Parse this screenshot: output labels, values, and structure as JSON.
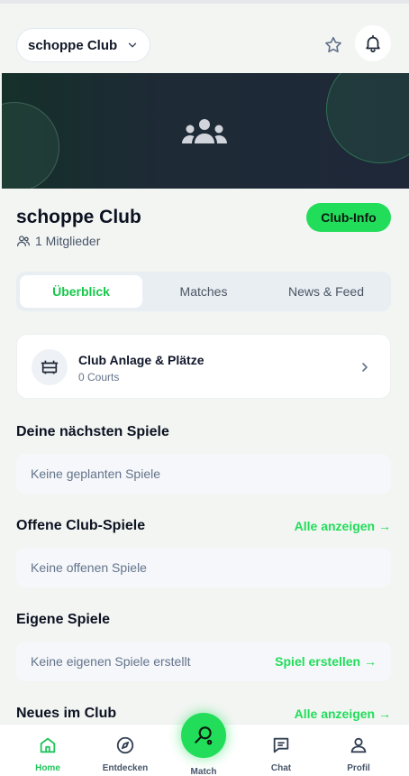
{
  "header": {
    "club_selector": "schoppe Club"
  },
  "club": {
    "name": "schoppe Club",
    "members": "1 Mitglieder",
    "info_button": "Club-Info"
  },
  "tabs": [
    {
      "label": "Überblick",
      "active": true
    },
    {
      "label": "Matches",
      "active": false
    },
    {
      "label": "News & Feed",
      "active": false
    }
  ],
  "courts": {
    "title": "Club Anlage & Plätze",
    "subtitle": "0 Courts"
  },
  "sections": {
    "next_games": {
      "title": "Deine nächsten Spiele",
      "empty": "Keine geplanten Spiele"
    },
    "open_games": {
      "title": "Offene Club-Spiele",
      "see_all": "Alle anzeigen →",
      "empty": "Keine offenen Spiele"
    },
    "own_games": {
      "title": "Eigene Spiele",
      "empty": "Keine eigenen Spiele erstellt",
      "action": "Spiel erstellen →"
    },
    "news": {
      "title": "Neues im Club",
      "see_all": "Alle anzeigen →"
    }
  },
  "nav": {
    "home": "Home",
    "explore": "Entdecken",
    "match": "Match",
    "chat": "Chat",
    "profile": "Profil"
  },
  "colors": {
    "accent": "#22dd5a",
    "banner_dark": "#1f2838"
  }
}
